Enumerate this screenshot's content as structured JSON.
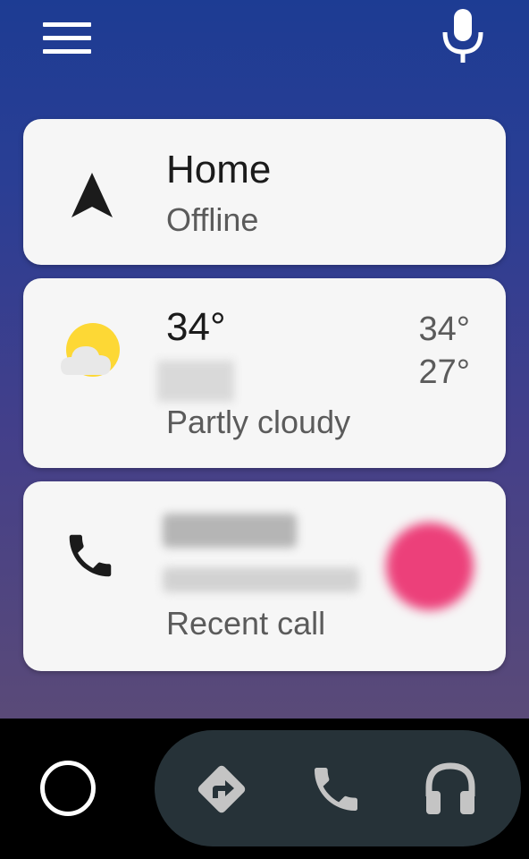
{
  "header": {
    "menu_icon": "menu-icon",
    "mic_icon": "microphone-icon"
  },
  "cards": {
    "navigation": {
      "icon": "navigation-arrow-icon",
      "title": "Home",
      "subtitle": "Offline"
    },
    "weather": {
      "icon": "partly-cloudy-icon",
      "temperature": "34°",
      "high": "34°",
      "low": "27°",
      "condition": "Partly cloudy"
    },
    "call": {
      "icon": "phone-icon",
      "subtitle": "Recent call"
    }
  },
  "bottom_nav": {
    "home_icon": "home-circle-icon",
    "items": [
      "directions-icon",
      "phone-icon",
      "headphones-icon"
    ]
  },
  "colors": {
    "gradient_top": "#1d3c93",
    "gradient_bottom": "#5a4a78",
    "card_bg": "#f6f6f6",
    "pill_bg": "#263238",
    "avatar_pink": "#ec407a",
    "sun_yellow": "#fdd835"
  }
}
